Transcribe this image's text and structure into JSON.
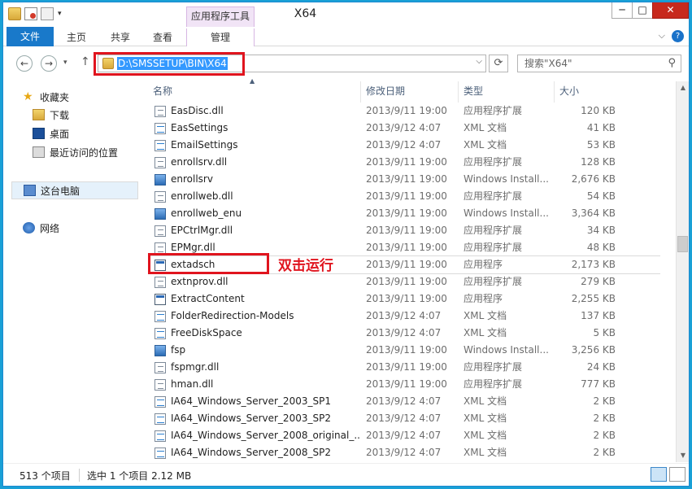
{
  "window": {
    "title": "X64",
    "context_tab_group": "应用程序工具",
    "controls": {
      "minimize": "─",
      "maximize": "□",
      "close": "✕"
    }
  },
  "ribbon": {
    "tabs": {
      "file": "文件",
      "home": "主页",
      "share": "共享",
      "view": "查看",
      "manage": "管理"
    },
    "collapse": "⌵",
    "help": "?"
  },
  "address": {
    "path": "D:\\SMSSETUP\\BIN\\X64",
    "search_placeholder": "搜索\"X64\""
  },
  "nav_pane": {
    "favorites": "收藏夹",
    "downloads": "下载",
    "desktop": "桌面",
    "recent": "最近访问的位置",
    "this_pc": "这台电脑",
    "network": "网络"
  },
  "columns": {
    "name": "名称",
    "date": "修改日期",
    "type": "类型",
    "size": "大小"
  },
  "files": [
    {
      "name": "EasDisc.dll",
      "date": "2013/9/11 19:00",
      "type": "应用程序扩展",
      "size": "120 KB",
      "icon": "dll"
    },
    {
      "name": "EasSettings",
      "date": "2013/9/12 4:07",
      "type": "XML 文档",
      "size": "41 KB",
      "icon": "xml"
    },
    {
      "name": "EmailSettings",
      "date": "2013/9/12 4:07",
      "type": "XML 文档",
      "size": "53 KB",
      "icon": "xml"
    },
    {
      "name": "enrollsrv.dll",
      "date": "2013/9/11 19:00",
      "type": "应用程序扩展",
      "size": "128 KB",
      "icon": "dll"
    },
    {
      "name": "enrollsrv",
      "date": "2013/9/11 19:00",
      "type": "Windows Install...",
      "size": "2,676 KB",
      "icon": "msi"
    },
    {
      "name": "enrollweb.dll",
      "date": "2013/9/11 19:00",
      "type": "应用程序扩展",
      "size": "54 KB",
      "icon": "dll"
    },
    {
      "name": "enrollweb_enu",
      "date": "2013/9/11 19:00",
      "type": "Windows Install...",
      "size": "3,364 KB",
      "icon": "msi"
    },
    {
      "name": "EPCtrlMgr.dll",
      "date": "2013/9/11 19:00",
      "type": "应用程序扩展",
      "size": "34 KB",
      "icon": "dll"
    },
    {
      "name": "EPMgr.dll",
      "date": "2013/9/11 19:00",
      "type": "应用程序扩展",
      "size": "48 KB",
      "icon": "dll"
    },
    {
      "name": "extadsch",
      "date": "2013/9/11 19:00",
      "type": "应用程序",
      "size": "2,173 KB",
      "icon": "exe"
    },
    {
      "name": "extnprov.dll",
      "date": "2013/9/11 19:00",
      "type": "应用程序扩展",
      "size": "279 KB",
      "icon": "dll"
    },
    {
      "name": "ExtractContent",
      "date": "2013/9/11 19:00",
      "type": "应用程序",
      "size": "2,255 KB",
      "icon": "exe"
    },
    {
      "name": "FolderRedirection-Models",
      "date": "2013/9/12 4:07",
      "type": "XML 文档",
      "size": "137 KB",
      "icon": "xml"
    },
    {
      "name": "FreeDiskSpace",
      "date": "2013/9/12 4:07",
      "type": "XML 文档",
      "size": "5 KB",
      "icon": "xml"
    },
    {
      "name": "fsp",
      "date": "2013/9/11 19:00",
      "type": "Windows Install...",
      "size": "3,256 KB",
      "icon": "msi"
    },
    {
      "name": "fspmgr.dll",
      "date": "2013/9/11 19:00",
      "type": "应用程序扩展",
      "size": "24 KB",
      "icon": "dll"
    },
    {
      "name": "hman.dll",
      "date": "2013/9/11 19:00",
      "type": "应用程序扩展",
      "size": "777 KB",
      "icon": "dll"
    },
    {
      "name": "IA64_Windows_Server_2003_SP1",
      "date": "2013/9/12 4:07",
      "type": "XML 文档",
      "size": "2 KB",
      "icon": "xml"
    },
    {
      "name": "IA64_Windows_Server_2003_SP2",
      "date": "2013/9/12 4:07",
      "type": "XML 文档",
      "size": "2 KB",
      "icon": "xml"
    },
    {
      "name": "IA64_Windows_Server_2008_original_...",
      "date": "2013/9/12 4:07",
      "type": "XML 文档",
      "size": "2 KB",
      "icon": "xml"
    },
    {
      "name": "IA64_Windows_Server_2008_SP2",
      "date": "2013/9/12 4:07",
      "type": "XML 文档",
      "size": "2 KB",
      "icon": "xml"
    }
  ],
  "annotation": {
    "callout": "双击运行",
    "color": "#e0141e"
  },
  "status": {
    "count": "513 个项目",
    "selection": "选中 1 个项目  2.12 MB"
  },
  "colors": {
    "accent": "#1979ca",
    "context_tab": "#f1e4f6",
    "selection": "#3399ff"
  }
}
